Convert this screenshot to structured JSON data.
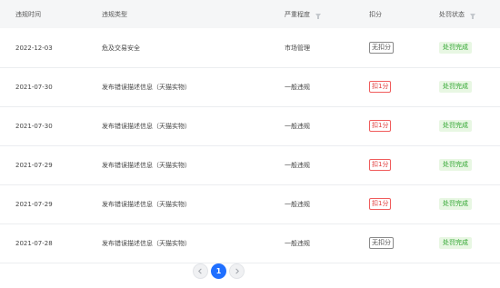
{
  "table": {
    "headers": {
      "time": "违规时间",
      "type": "违规类型",
      "severity": "严重程度",
      "points": "扣分",
      "status": "处罚状态"
    },
    "rows": [
      {
        "time": "2022-12-03",
        "type": "危及交易安全",
        "severity": "市场管理",
        "points": "无扣分",
        "points_kind": "none",
        "status": "处罚完成"
      },
      {
        "time": "2021-07-30",
        "type": "发布错误描述信息（天猫实物）",
        "severity": "一般违规",
        "points": "扣1分",
        "points_kind": "deduct",
        "status": "处罚完成"
      },
      {
        "time": "2021-07-30",
        "type": "发布错误描述信息（天猫实物）",
        "severity": "一般违规",
        "points": "扣1分",
        "points_kind": "deduct",
        "status": "处罚完成"
      },
      {
        "time": "2021-07-29",
        "type": "发布错误描述信息（天猫实物）",
        "severity": "一般违规",
        "points": "扣1分",
        "points_kind": "deduct",
        "status": "处罚完成"
      },
      {
        "time": "2021-07-29",
        "type": "发布错误描述信息（天猫实物）",
        "severity": "一般违规",
        "points": "扣1分",
        "points_kind": "deduct",
        "status": "处罚完成"
      },
      {
        "time": "2021-07-28",
        "type": "发布错误描述信息（天猫实物）",
        "severity": "一般违规",
        "points": "无扣分",
        "points_kind": "none",
        "status": "处罚完成"
      }
    ]
  },
  "pagination": {
    "current_page": "1",
    "prev_icon": "chevron-left-icon",
    "next_icon": "chevron-right-icon"
  },
  "colors": {
    "accent": "#1f6fff",
    "deduct": "#e03c3c",
    "status_bg": "#e8f7e3",
    "status_text": "#2fa52f"
  }
}
